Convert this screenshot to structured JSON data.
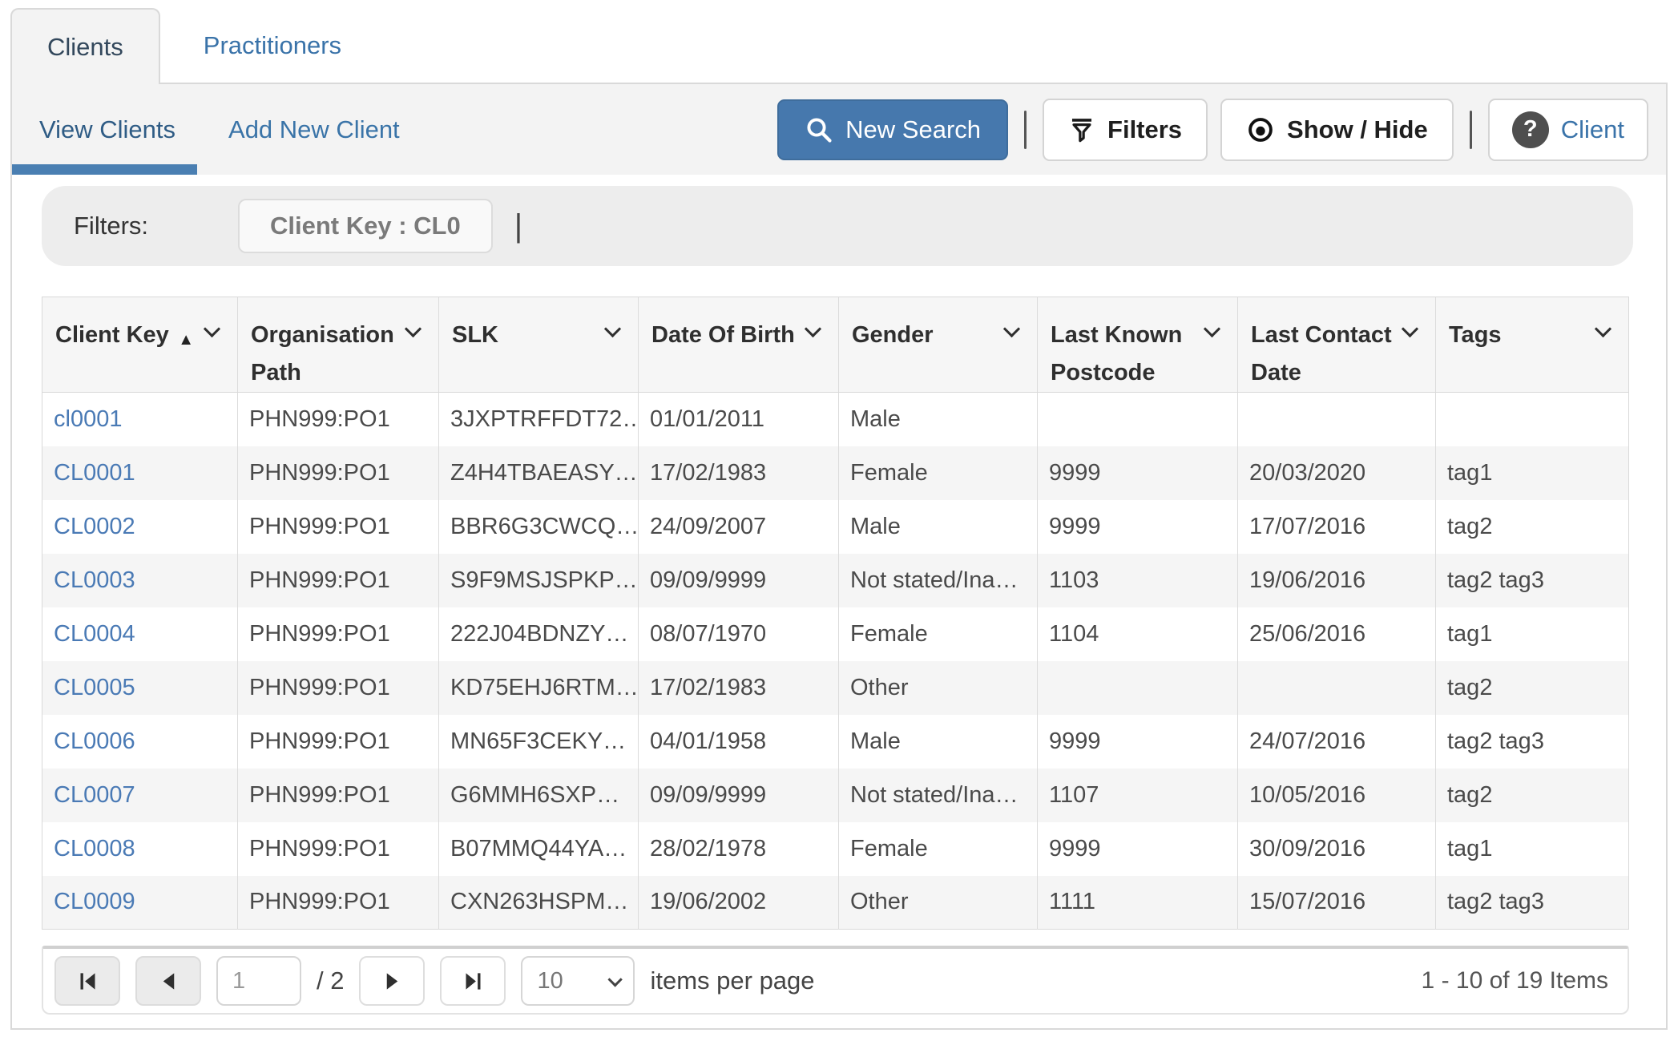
{
  "tabs": {
    "clients": "Clients",
    "practitioners": "Practitioners"
  },
  "subnav": {
    "view_clients": "View Clients",
    "add_new_client": "Add New Client"
  },
  "toolbar": {
    "new_search": "New Search",
    "filters": "Filters",
    "show_hide": "Show / Hide",
    "client_help": "Client",
    "help_glyph": "?",
    "separator": "|"
  },
  "filter_bar": {
    "label": "Filters:",
    "chip": "Client Key : CL0",
    "separator": "|"
  },
  "table": {
    "sort_asc_glyph": "▲",
    "columns": [
      {
        "label": "Client Key",
        "sorted": "asc"
      },
      {
        "label": "Organisation Path"
      },
      {
        "label": "SLK"
      },
      {
        "label": "Date Of Birth"
      },
      {
        "label": "Gender"
      },
      {
        "label": "Last Known Postcode"
      },
      {
        "label": "Last Contact Date"
      },
      {
        "label": "Tags"
      }
    ],
    "rows": [
      [
        "cl0001",
        "PHN999:PO1",
        "3JXPTRFFDT72…",
        "01/01/2011",
        "Male",
        "",
        "",
        ""
      ],
      [
        "CL0001",
        "PHN999:PO1",
        "Z4H4TBAEASY…",
        "17/02/1983",
        "Female",
        "9999",
        "20/03/2020",
        "tag1"
      ],
      [
        "CL0002",
        "PHN999:PO1",
        "BBR6G3CWCQ…",
        "24/09/2007",
        "Male",
        "9999",
        "17/07/2016",
        "tag2"
      ],
      [
        "CL0003",
        "PHN999:PO1",
        "S9F9MSJSPKP…",
        "09/09/9999",
        "Not stated/Ina…",
        "1103",
        "19/06/2016",
        "tag2 tag3"
      ],
      [
        "CL0004",
        "PHN999:PO1",
        "222J04BDNZY…",
        "08/07/1970",
        "Female",
        "1104",
        "25/06/2016",
        "tag1"
      ],
      [
        "CL0005",
        "PHN999:PO1",
        "KD75EHJ6RTM…",
        "17/02/1983",
        "Other",
        "",
        "",
        "tag2"
      ],
      [
        "CL0006",
        "PHN999:PO1",
        "MN65F3CEKY…",
        "04/01/1958",
        "Male",
        "9999",
        "24/07/2016",
        "tag2 tag3"
      ],
      [
        "CL0007",
        "PHN999:PO1",
        "G6MMH6SXP…",
        "09/09/9999",
        "Not stated/Ina…",
        "1107",
        "10/05/2016",
        "tag2"
      ],
      [
        "CL0008",
        "PHN999:PO1",
        "B07MMQ44YA…",
        "28/02/1978",
        "Female",
        "9999",
        "30/09/2016",
        "tag1"
      ],
      [
        "CL0009",
        "PHN999:PO1",
        "CXN263HSPM…",
        "19/06/2002",
        "Other",
        "1111",
        "15/07/2016",
        "tag2 tag3"
      ]
    ]
  },
  "pager": {
    "page": "1",
    "of_pages": "/ 2",
    "page_size": "10",
    "items_per_page": "items per page",
    "range": "1 - 10 of 19 Items"
  },
  "colors": {
    "accent_blue": "#4678ad",
    "link_blue": "#4a7ab5",
    "indicator_blue": "#4a7fb2",
    "strip_gray": "#f3f3f3",
    "filter_bar_gray": "#ededed",
    "alt_row_gray": "#f5f5f5"
  }
}
